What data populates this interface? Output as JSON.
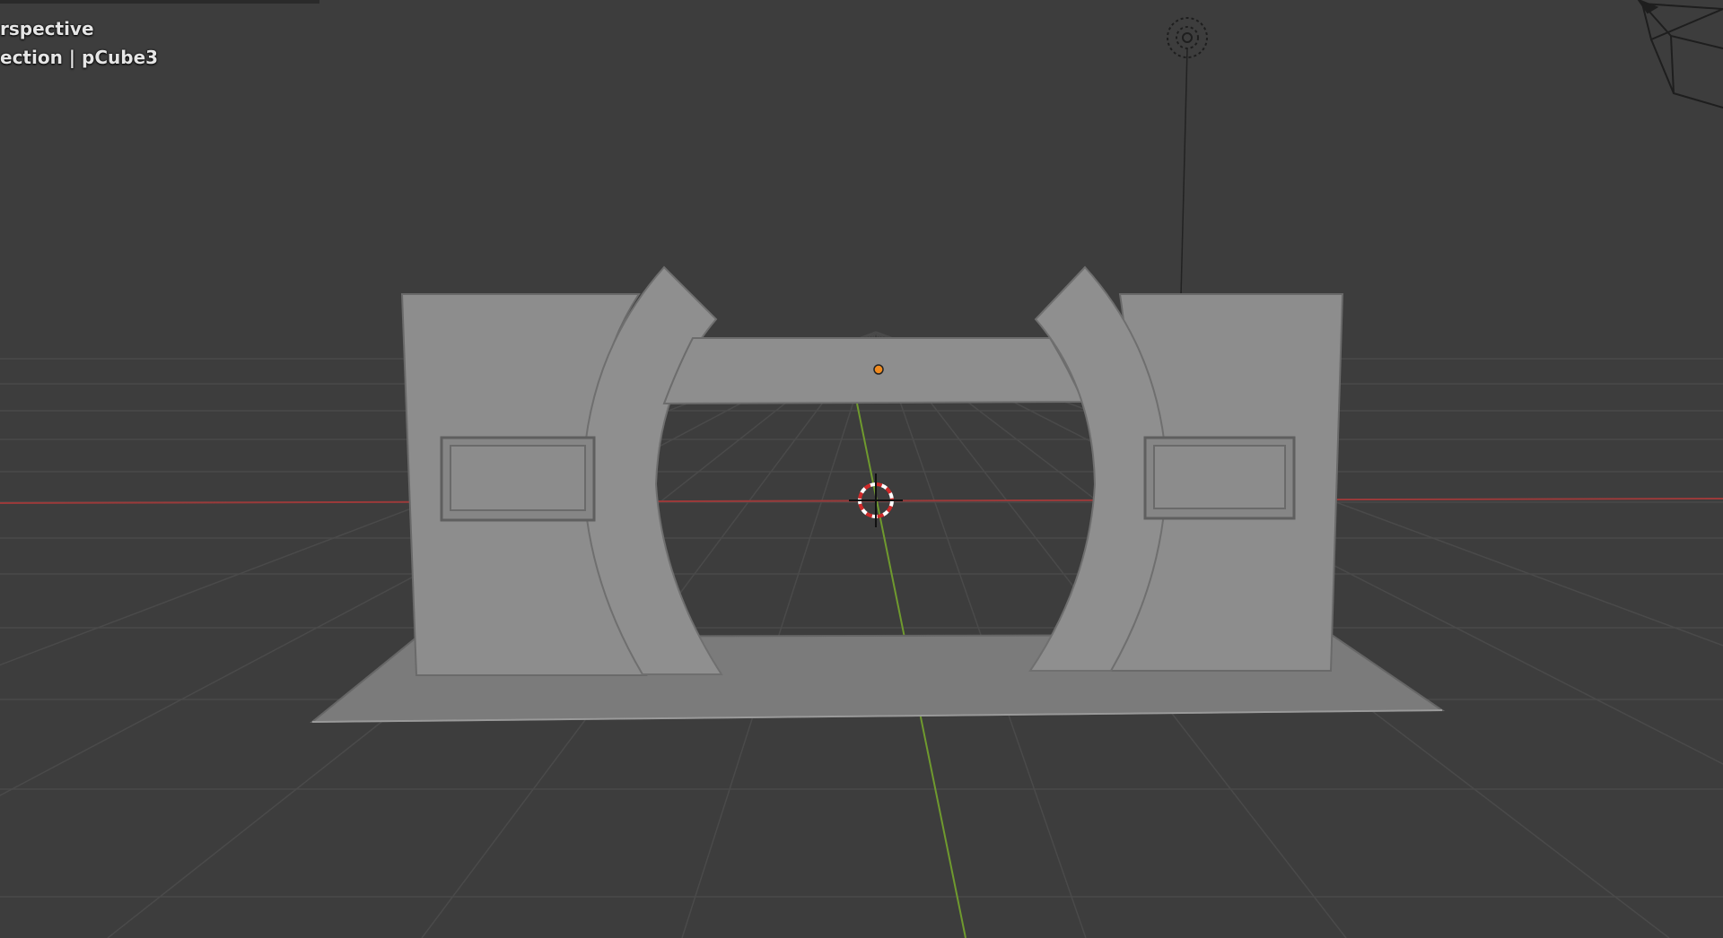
{
  "viewport": {
    "view_mode": "rspective",
    "collection_text": "ection | pCube3",
    "icons": [
      "light-object-icon",
      "camera-object-icon",
      "3d-cursor-icon",
      "object-origin-icon"
    ],
    "colors": {
      "background": "#3d3d3d",
      "grid": "#4a4a4a",
      "x_axis": "#9b3a3a",
      "y_axis": "#6f9a2e",
      "mesh_front": "#8e8e8e",
      "mesh_base": "#7a7a7a",
      "origin_dot": "#f08a1e"
    }
  }
}
